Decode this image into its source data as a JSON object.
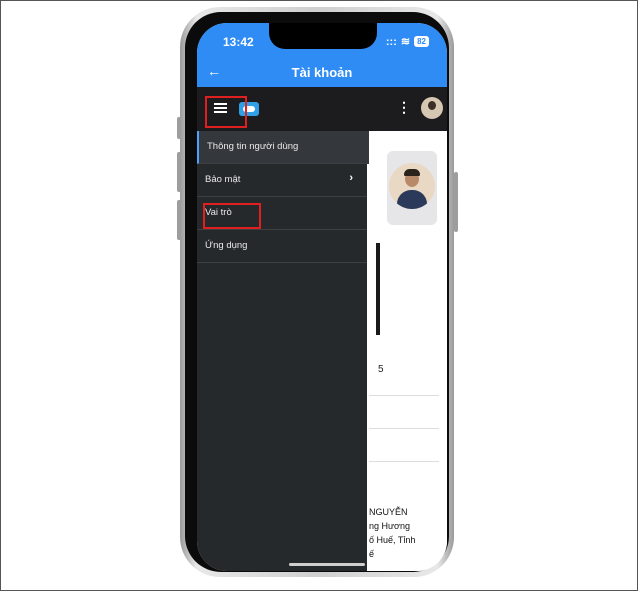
{
  "status_bar": {
    "time": "13:42",
    "signal": ":::",
    "wifi": "≋",
    "battery": "82"
  },
  "header": {
    "back_glyph": "←",
    "title": "Tài khoản"
  },
  "navbar": {
    "menu_glyph": "≡",
    "more_glyph": "⋮"
  },
  "drawer": {
    "items": [
      {
        "label": "Thông tin người dùng",
        "active": true
      },
      {
        "label": "Bảo mật",
        "has_chevron": true,
        "chevron": "›"
      },
      {
        "label": "Vai trò"
      },
      {
        "label": "Ứng dụng"
      }
    ]
  },
  "profile": {
    "id_fragment": "5",
    "address_fragment": "NGUYỄN\nng Hương\nố Huế, Tỉnh\nế"
  },
  "colors": {
    "header_blue": "#2f8cf5",
    "drawer_bg": "#26292c",
    "highlight_red": "#e02020"
  }
}
